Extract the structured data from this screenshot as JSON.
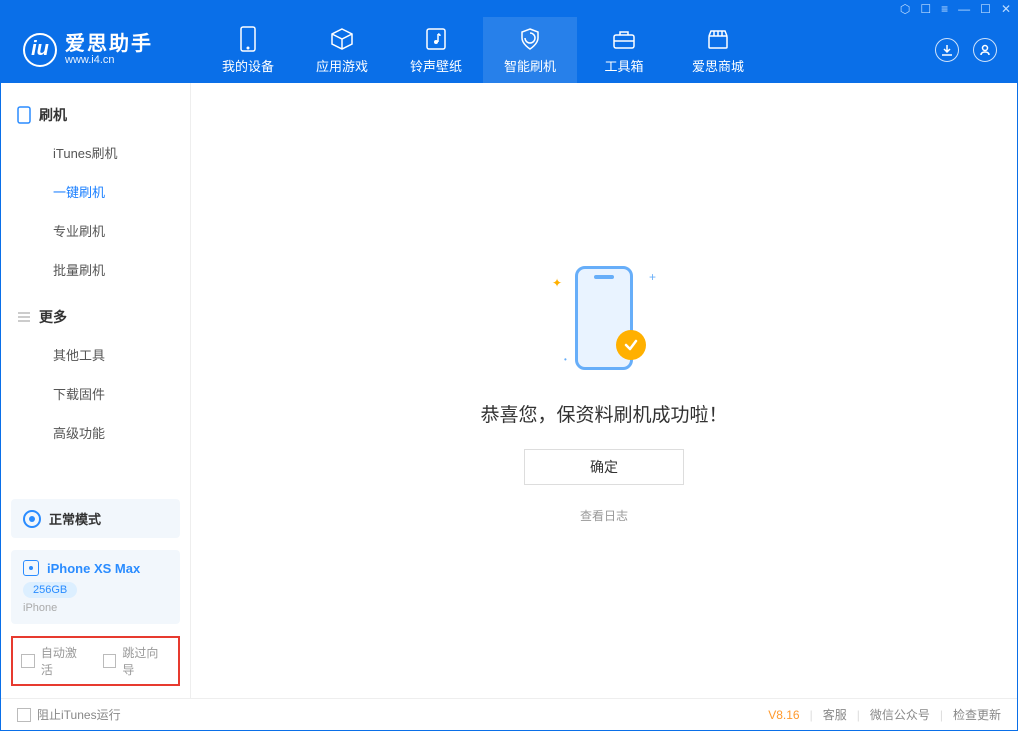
{
  "app": {
    "name": "爱思助手",
    "url": "www.i4.cn"
  },
  "nav": {
    "items": [
      {
        "label": "我的设备"
      },
      {
        "label": "应用游戏"
      },
      {
        "label": "铃声壁纸"
      },
      {
        "label": "智能刷机"
      },
      {
        "label": "工具箱"
      },
      {
        "label": "爱思商城"
      }
    ]
  },
  "sidebar": {
    "section1": {
      "title": "刷机"
    },
    "items1": [
      {
        "label": "iTunes刷机"
      },
      {
        "label": "一键刷机"
      },
      {
        "label": "专业刷机"
      },
      {
        "label": "批量刷机"
      }
    ],
    "section2": {
      "title": "更多"
    },
    "items2": [
      {
        "label": "其他工具"
      },
      {
        "label": "下载固件"
      },
      {
        "label": "高级功能"
      }
    ]
  },
  "mode": {
    "label": "正常模式"
  },
  "device": {
    "name": "iPhone XS Max",
    "capacity": "256GB",
    "type": "iPhone"
  },
  "options": {
    "auto_activate": "自动激活",
    "skip_guide": "跳过向导"
  },
  "main": {
    "success": "恭喜您，保资料刷机成功啦！",
    "ok": "确定",
    "view_log": "查看日志"
  },
  "footer": {
    "block_itunes": "阻止iTunes运行",
    "version": "V8.16",
    "links": [
      "客服",
      "微信公众号",
      "检查更新"
    ]
  }
}
